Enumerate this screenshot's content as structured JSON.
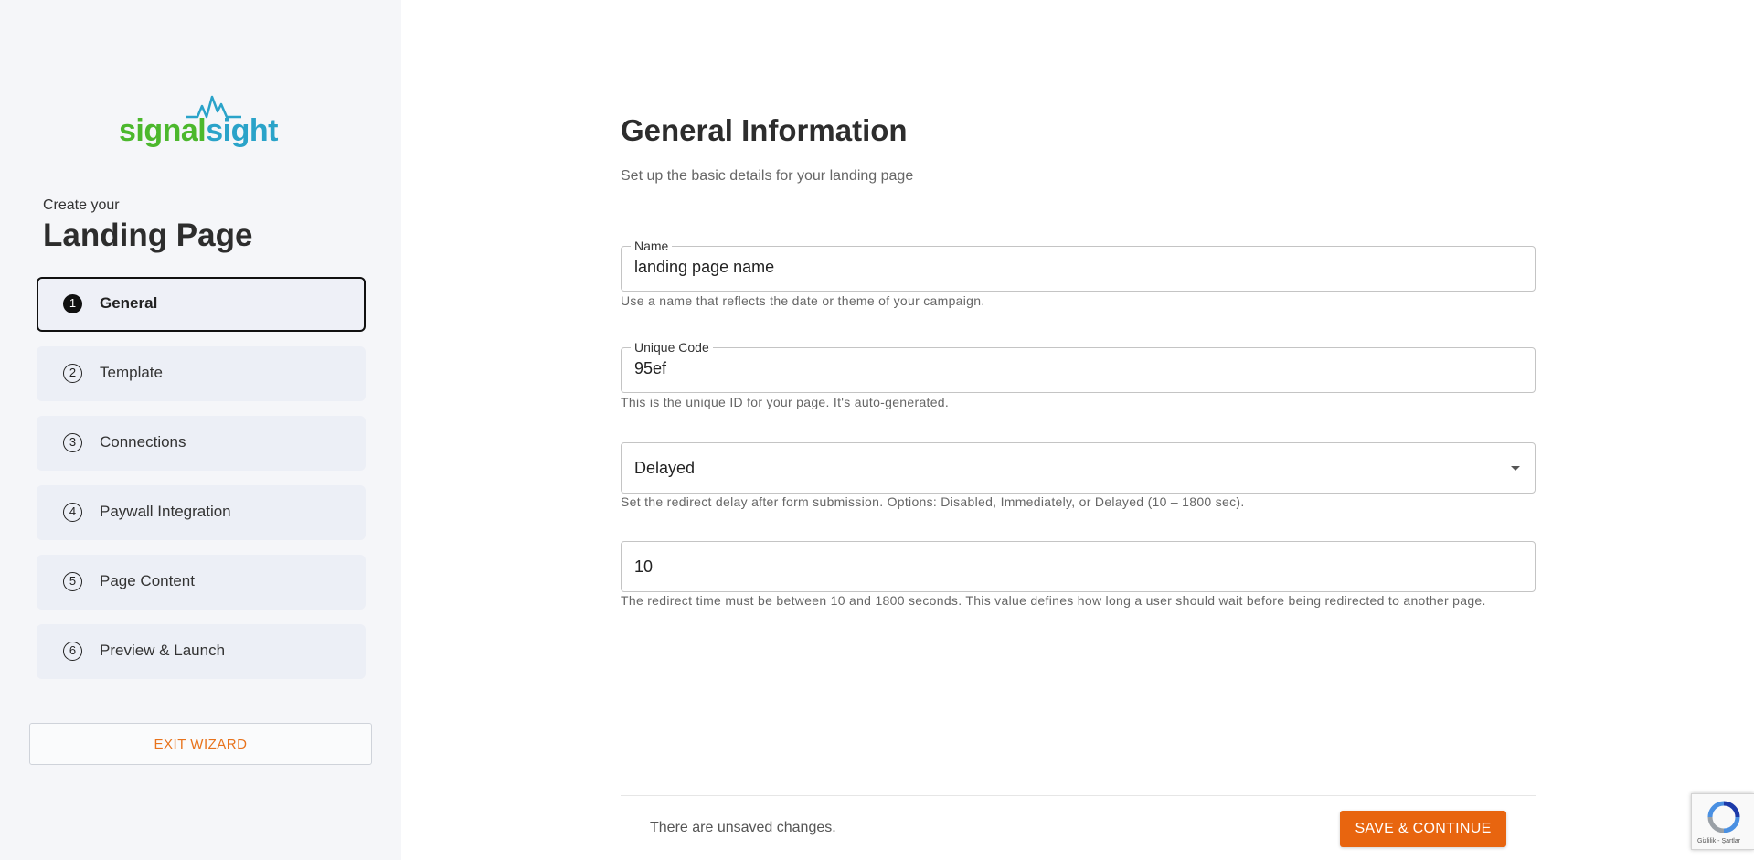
{
  "logo": {
    "part1": "signal",
    "part2": "sight"
  },
  "sidebar": {
    "pre_title": "Create your",
    "title": "Landing Page",
    "steps": [
      {
        "num": "1",
        "label": "General"
      },
      {
        "num": "2",
        "label": "Template"
      },
      {
        "num": "3",
        "label": "Connections"
      },
      {
        "num": "4",
        "label": "Paywall Integration"
      },
      {
        "num": "5",
        "label": "Page Content"
      },
      {
        "num": "6",
        "label": "Preview & Launch"
      }
    ],
    "active_step": "General",
    "exit_label": "EXIT WIZARD"
  },
  "main": {
    "title": "General Information",
    "subtitle": "Set up the basic details for your landing page",
    "name_field": {
      "label": "Name",
      "value": "landing page name",
      "helper": "Use a name that reflects the date or theme of your campaign."
    },
    "code_field": {
      "label": "Unique Code",
      "value": "95ef",
      "helper": "This is the unique ID for your page. It's auto-generated."
    },
    "redirect_select": {
      "value": "Delayed",
      "helper": "Set the redirect delay after form submission. Options: Disabled, Immediately, or Delayed (10 – 1800 sec)."
    },
    "redirect_time": {
      "value": "10",
      "helper": "The redirect time must be between 10 and 1800 seconds. This value defines how long a user should wait before being redirected to another page."
    }
  },
  "footer": {
    "status": "There are unsaved changes.",
    "save_label": "SAVE & CONTINUE"
  },
  "recaptcha": {
    "text": "Gizlilik - Şartlar"
  },
  "colors": {
    "accent": "#e8650f",
    "logo_green": "#4cb82d",
    "logo_blue": "#2aa3c9",
    "sidebar_bg": "#f5f6f9"
  }
}
